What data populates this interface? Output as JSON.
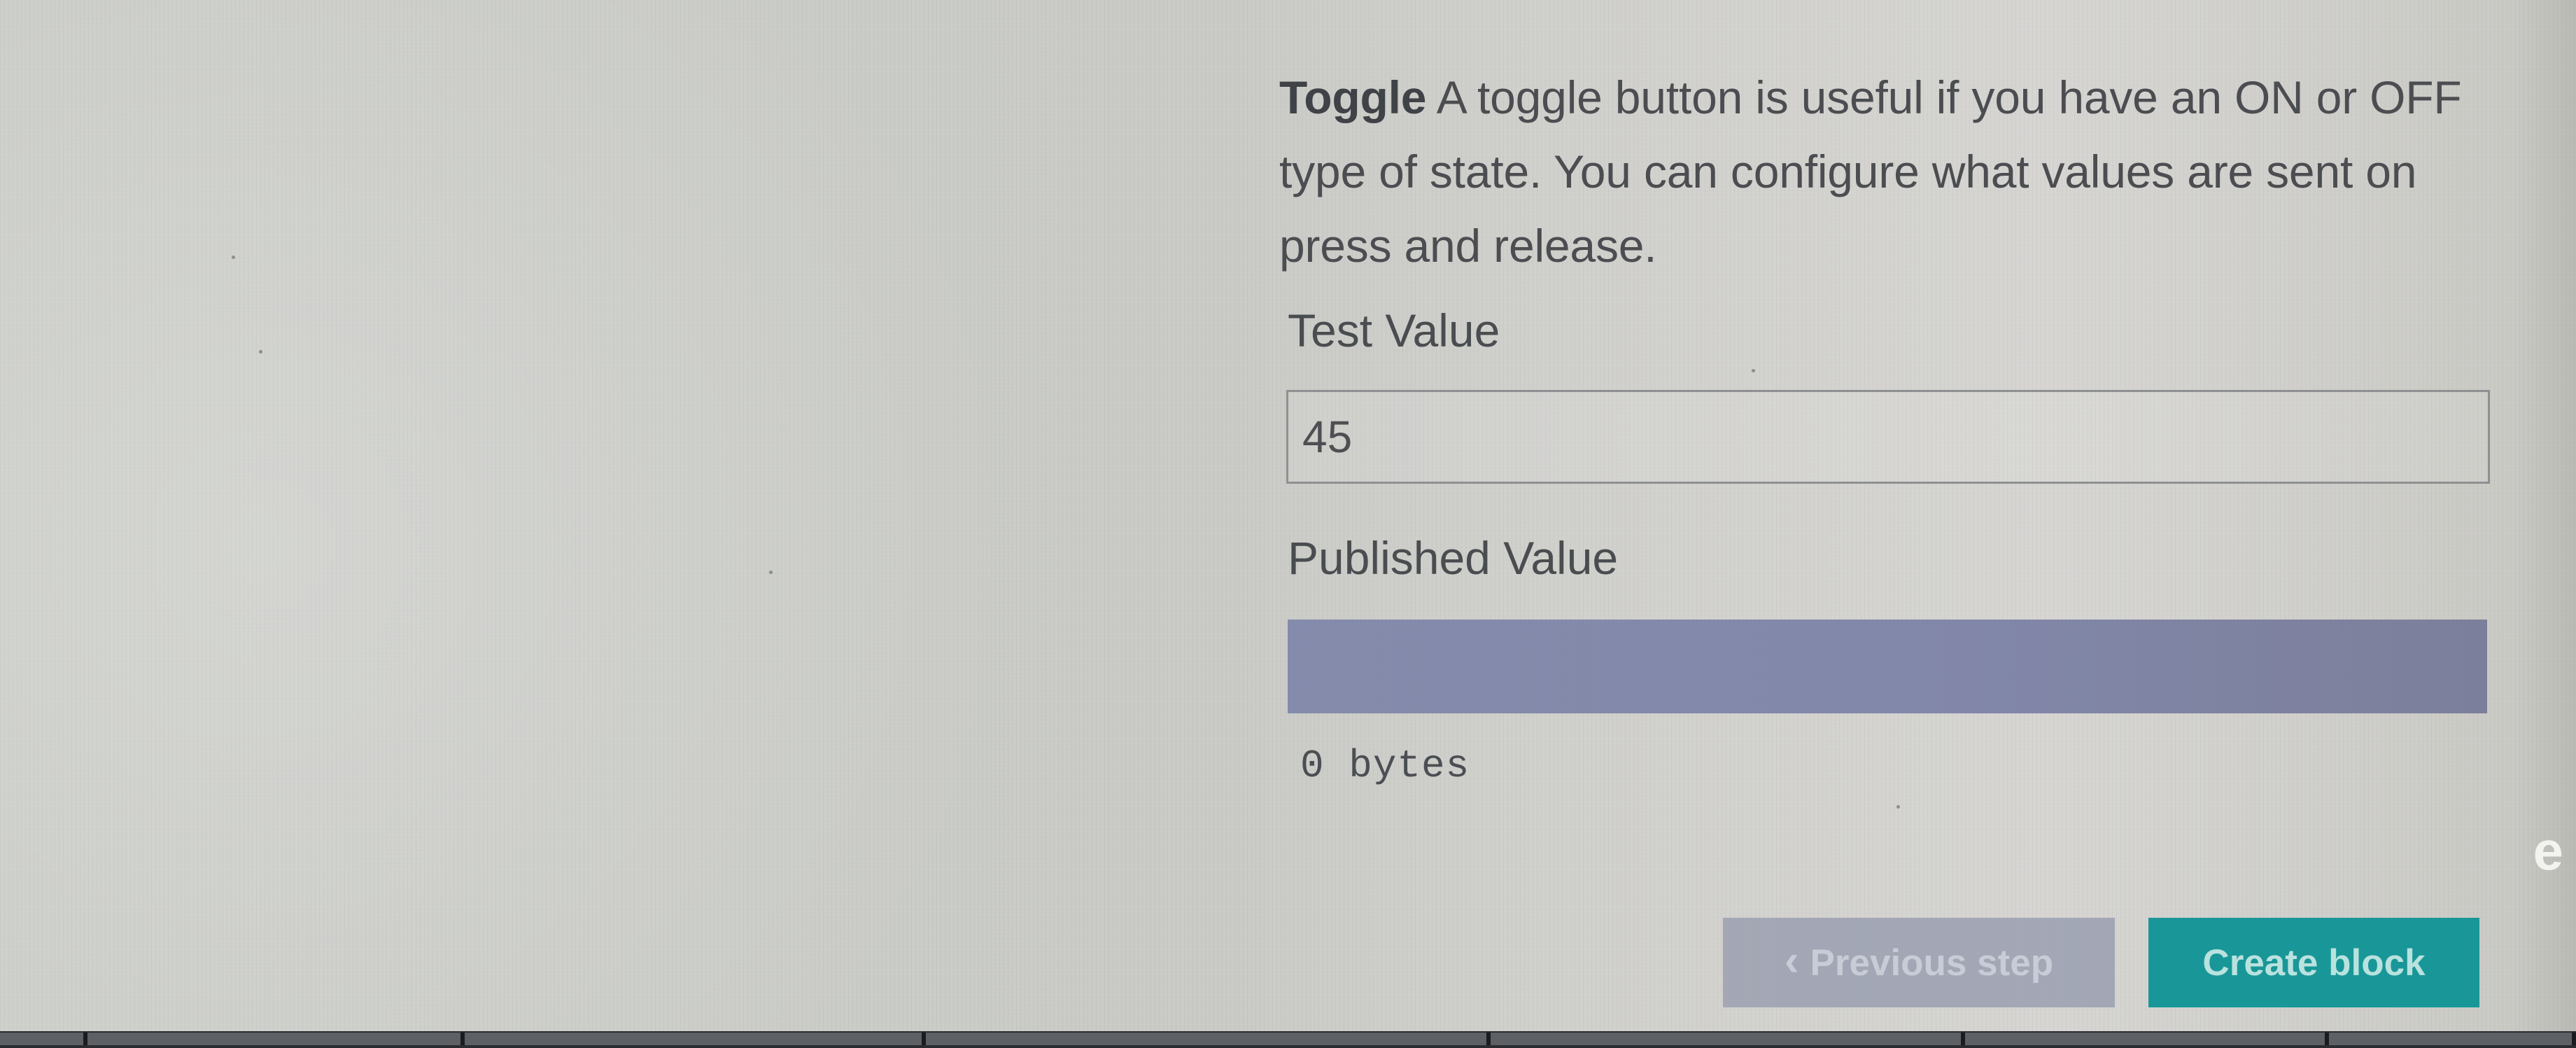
{
  "description": {
    "emphasis": "Toggle",
    "text": "A toggle button is useful if you have an ON or OFF type of state. You can configure what values are sent on press and release."
  },
  "fields": {
    "test_value": {
      "label": "Test Value",
      "value": "45",
      "placeholder": ""
    },
    "published_value": {
      "label": "Published Value",
      "size_text": "0 bytes"
    }
  },
  "actions": {
    "previous_step": "Previous step",
    "create_block": "Create block"
  },
  "right_edge": {
    "partial_text": "e"
  },
  "icons": {
    "previous": "chevron-left-icon"
  },
  "colors": {
    "accent": "#199798",
    "disabled_button": "#9ea3b3",
    "published_value_bar": "#7d83a7"
  }
}
